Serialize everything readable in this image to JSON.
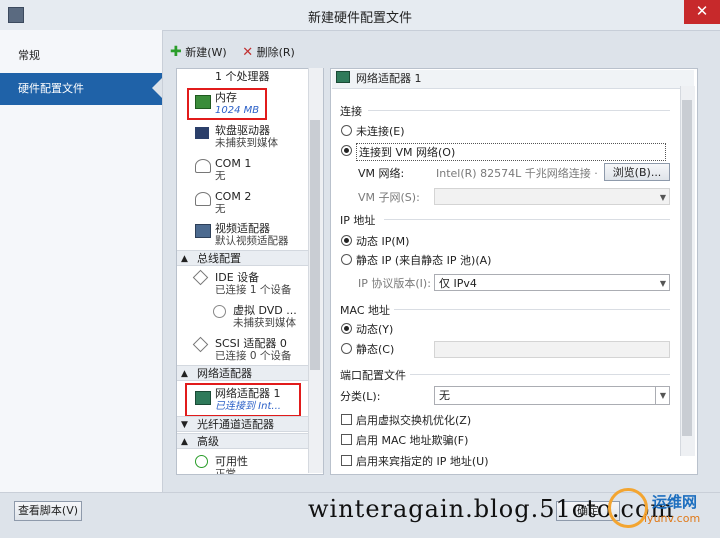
{
  "window": {
    "title": "新建硬件配置文件",
    "close_glyph": "✕"
  },
  "left_nav": {
    "items": [
      {
        "label": "常规"
      },
      {
        "label": "硬件配置文件"
      }
    ]
  },
  "toolbar": {
    "new_label": "新建(W)",
    "delete_label": "删除(R)"
  },
  "tree": {
    "processor_sub": "1 个处理器",
    "memory": {
      "label": "内存",
      "sub": "1024 MB"
    },
    "floppy": {
      "label": "软盘驱动器",
      "sub": "未捕获到媒体"
    },
    "com1": {
      "label": "COM 1",
      "sub": "无"
    },
    "com2": {
      "label": "COM 2",
      "sub": "无"
    },
    "video": {
      "label": "视频适配器",
      "sub": "默认视频适配器"
    },
    "section_bus": "总线配置",
    "ide": {
      "label": "IDE 设备",
      "sub": "已连接 1 个设备"
    },
    "dvd": {
      "label": "虚拟 DVD ...",
      "sub": "未捕获到媒体"
    },
    "scsi": {
      "label": "SCSI 适配器 0",
      "sub": "已连接 0 个设备"
    },
    "section_net": "网络适配器",
    "nic": {
      "label": "网络适配器 1",
      "sub": "已连接到 Int..."
    },
    "section_fc": "光纤通道适配器",
    "section_adv": "高级",
    "avail": {
      "label": "可用性",
      "sub": "正常"
    }
  },
  "panel": {
    "header": "网络适配器 1",
    "connect_group": "连接",
    "opt_unconnected": "未连接(E)",
    "opt_vm_network": "连接到 VM 网络(O)",
    "vm_network_label": "VM 网络:",
    "vm_network_value": "Intel(R) 82574L 千兆网络连接 ·",
    "browse_button": "浏览(B)...",
    "vm_subnet_label": "VM 子网(S):",
    "ip_group": "IP 地址",
    "opt_dynamic_ip": "动态 IP(M)",
    "opt_static_ip": "静态 IP (来自静态 IP 池)(A)",
    "ip_protocol_label": "IP 协议版本(I):",
    "ip_protocol_value": "仅 IPv4",
    "mac_group": "MAC 地址",
    "opt_mac_dynamic": "动态(Y)",
    "opt_mac_static": "静态(C)",
    "port_profile_group": "端口配置文件",
    "classification_label": "分类(L):",
    "classification_value": "无",
    "cb_virtual_switch": "启用虚拟交换机优化(Z)",
    "cb_mac_spoof": "启用 MAC 地址欺骗(F)",
    "cb_guest_ip": "启用来宾指定的 IP 地址(U)"
  },
  "bottom": {
    "view_script": "查看脚本(V)",
    "ok_button": "确定"
  },
  "watermark": {
    "text": "winteragain.blog.51cto.com",
    "logo_title": "运维网",
    "logo_url": "iyunv.com"
  },
  "colors": {
    "nav_active": "#1f62a8",
    "highlight_box": "#e11b1b",
    "close": "#c7292b"
  }
}
